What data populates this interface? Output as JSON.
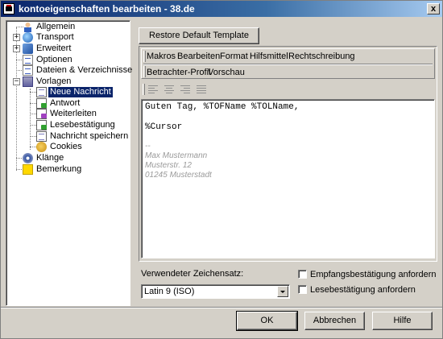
{
  "window": {
    "title": "kontoeigenschaften bearbeiten - 38.de",
    "close_glyph": "x"
  },
  "tree": {
    "items": [
      {
        "label": "Allgemein",
        "icon": "person-icon"
      },
      {
        "label": "Transport",
        "icon": "globe-icon",
        "expander": "+"
      },
      {
        "label": "Erweitert",
        "icon": "gear-icon",
        "expander": "+"
      },
      {
        "label": "Optionen",
        "icon": "note-icon"
      },
      {
        "label": "Dateien & Verzeichnisse",
        "icon": "folder-tree-icon"
      },
      {
        "label": "Vorlagen",
        "icon": "templates-icon",
        "expander": "−"
      },
      {
        "label": "Neue Nachricht",
        "icon": "document-icon",
        "selected": true
      },
      {
        "label": "Antwort",
        "icon": "reply-document-icon"
      },
      {
        "label": "Weiterleiten",
        "icon": "forward-document-icon"
      },
      {
        "label": "Lesebestätigung",
        "icon": "receipt-document-icon"
      },
      {
        "label": "Nachricht speichern",
        "icon": "save-document-icon"
      },
      {
        "label": "Cookies",
        "icon": "cookie-icon"
      },
      {
        "label": "Klänge",
        "icon": "sound-icon"
      },
      {
        "label": "Bemerkung",
        "icon": "sticky-note-icon"
      }
    ]
  },
  "restore_button": "Restore Default Template",
  "menu": {
    "row1": [
      "Makros",
      "Bearbeiten",
      "Format",
      "Hilfsmittel",
      "Rechtschreibung"
    ],
    "row2": [
      "Betrachter-Profil",
      "Vorschau"
    ]
  },
  "toolbar": [
    "align-left-icon",
    "align-center-icon",
    "align-right-icon",
    "justify-icon"
  ],
  "editor": {
    "line1": "Guten Tag, %TOFName %TOLName,",
    "line2": "%Cursor",
    "sig_sep": "--",
    "sig_name": "Max Mustermann",
    "sig_street": "Musterstr. 12",
    "sig_city": "01245 Musterstadt"
  },
  "charset": {
    "label": "Verwendeter Zeichensatz:",
    "value": "Latin 9 (ISO)"
  },
  "checkboxes": {
    "receipt": {
      "label": "Empfangsbestätigung anfordern",
      "checked": false
    },
    "read": {
      "label": "Lesebestätigung anfordern",
      "checked": false
    }
  },
  "buttons": {
    "ok": "OK",
    "cancel": "Abbrechen",
    "help": "Hilfe"
  },
  "colors": {
    "titlebar": "#0a246a",
    "selection": "#0a246a",
    "face": "#d4d0c8",
    "signature": "#9a9a9a"
  }
}
